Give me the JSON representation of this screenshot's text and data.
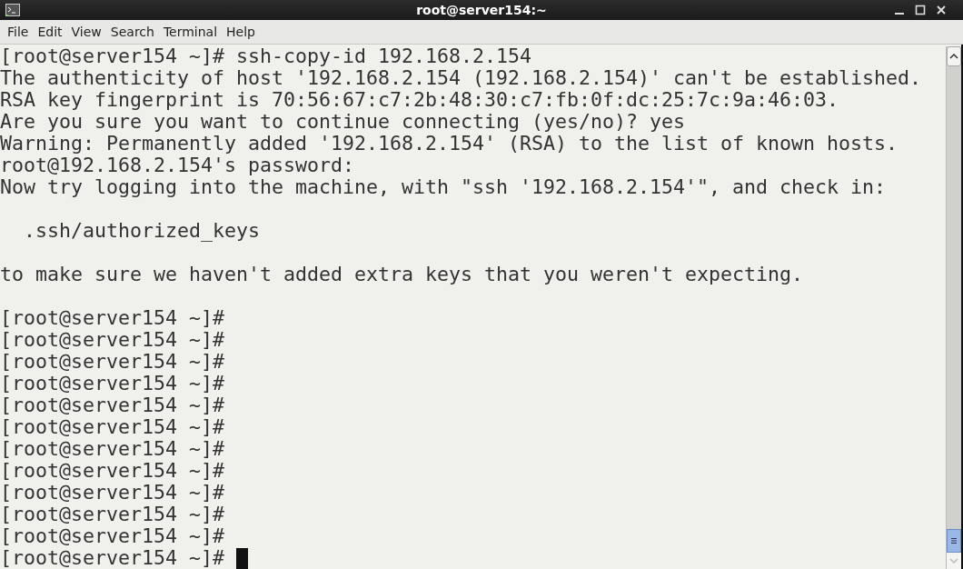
{
  "window": {
    "title": "root@server154:~"
  },
  "menu": [
    "File",
    "Edit",
    "View",
    "Search",
    "Terminal",
    "Help"
  ],
  "terminal": {
    "lines": [
      {
        "kind": "text",
        "text": "[root@server154 ~]# ssh-copy-id 192.168.2.154"
      },
      {
        "kind": "text",
        "text": "The authenticity of host '192.168.2.154 (192.168.2.154)' can't be established."
      },
      {
        "kind": "text",
        "text": "RSA key fingerprint is 70:56:67:c7:2b:48:30:c7:fb:0f:dc:25:7c:9a:46:03."
      },
      {
        "kind": "text",
        "text": "Are you sure you want to continue connecting (yes/no)? yes"
      },
      {
        "kind": "text",
        "text": "Warning: Permanently added '192.168.2.154' (RSA) to the list of known hosts."
      },
      {
        "kind": "text",
        "text": "root@192.168.2.154's password:"
      },
      {
        "kind": "text",
        "text": "Now try logging into the machine, with \"ssh '192.168.2.154'\", and check in:"
      },
      {
        "kind": "blank"
      },
      {
        "kind": "text",
        "text": "  .ssh/authorized_keys"
      },
      {
        "kind": "blank"
      },
      {
        "kind": "text",
        "text": "to make sure we haven't added extra keys that you weren't expecting."
      },
      {
        "kind": "blank"
      },
      {
        "kind": "text",
        "text": "[root@server154 ~]#"
      },
      {
        "kind": "text",
        "text": "[root@server154 ~]#"
      },
      {
        "kind": "text",
        "text": "[root@server154 ~]#"
      },
      {
        "kind": "text",
        "text": "[root@server154 ~]#"
      },
      {
        "kind": "text",
        "text": "[root@server154 ~]#"
      },
      {
        "kind": "text",
        "text": "[root@server154 ~]#"
      },
      {
        "kind": "text",
        "text": "[root@server154 ~]#"
      },
      {
        "kind": "text",
        "text": "[root@server154 ~]#"
      },
      {
        "kind": "text",
        "text": "[root@server154 ~]#"
      },
      {
        "kind": "text",
        "text": "[root@server154 ~]#"
      },
      {
        "kind": "text",
        "text": "[root@server154 ~]#"
      },
      {
        "kind": "text",
        "text": "[root@server154 ~]#",
        "cursor": true
      }
    ]
  }
}
